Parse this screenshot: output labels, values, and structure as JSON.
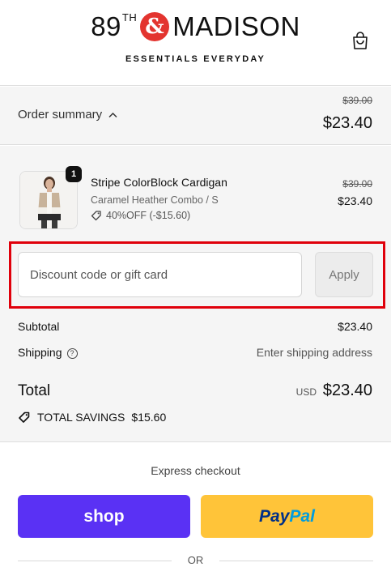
{
  "header": {
    "logo_num": "89",
    "logo_sup": "TH",
    "logo_amp": "&",
    "logo_name": "MADISON",
    "tagline": "ESSENTIALS EVERYDAY",
    "cart_icon": "shopping-bag-icon"
  },
  "summary": {
    "label": "Order summary",
    "chevron": "^",
    "original_total": "$39.00",
    "total": "$23.40"
  },
  "product": {
    "quantity": "1",
    "name": "Stripe ColorBlock Cardigan",
    "variant": "Caramel Heather Combo / S",
    "discount": "40%OFF (-$15.60)",
    "original_price": "$39.00",
    "price": "$23.40"
  },
  "discount": {
    "placeholder": "Discount code or gift card",
    "apply_label": "Apply"
  },
  "totals": {
    "subtotal_label": "Subtotal",
    "subtotal_value": "$23.40",
    "shipping_label": "Shipping",
    "shipping_value": "Enter shipping address",
    "total_label": "Total",
    "currency": "USD",
    "total_value": "$23.40",
    "savings_label": "TOTAL SAVINGS",
    "savings_value": "$15.60"
  },
  "express": {
    "title": "Express checkout",
    "shop_label": "shop",
    "paypal_pay": "Pay",
    "paypal_pal": "Pal",
    "or_label": "OR"
  },
  "colors": {
    "shop": "#5a31f4",
    "paypal": "#ffc439",
    "highlight": "#e0000b",
    "logo_accent": "#e3342f"
  }
}
